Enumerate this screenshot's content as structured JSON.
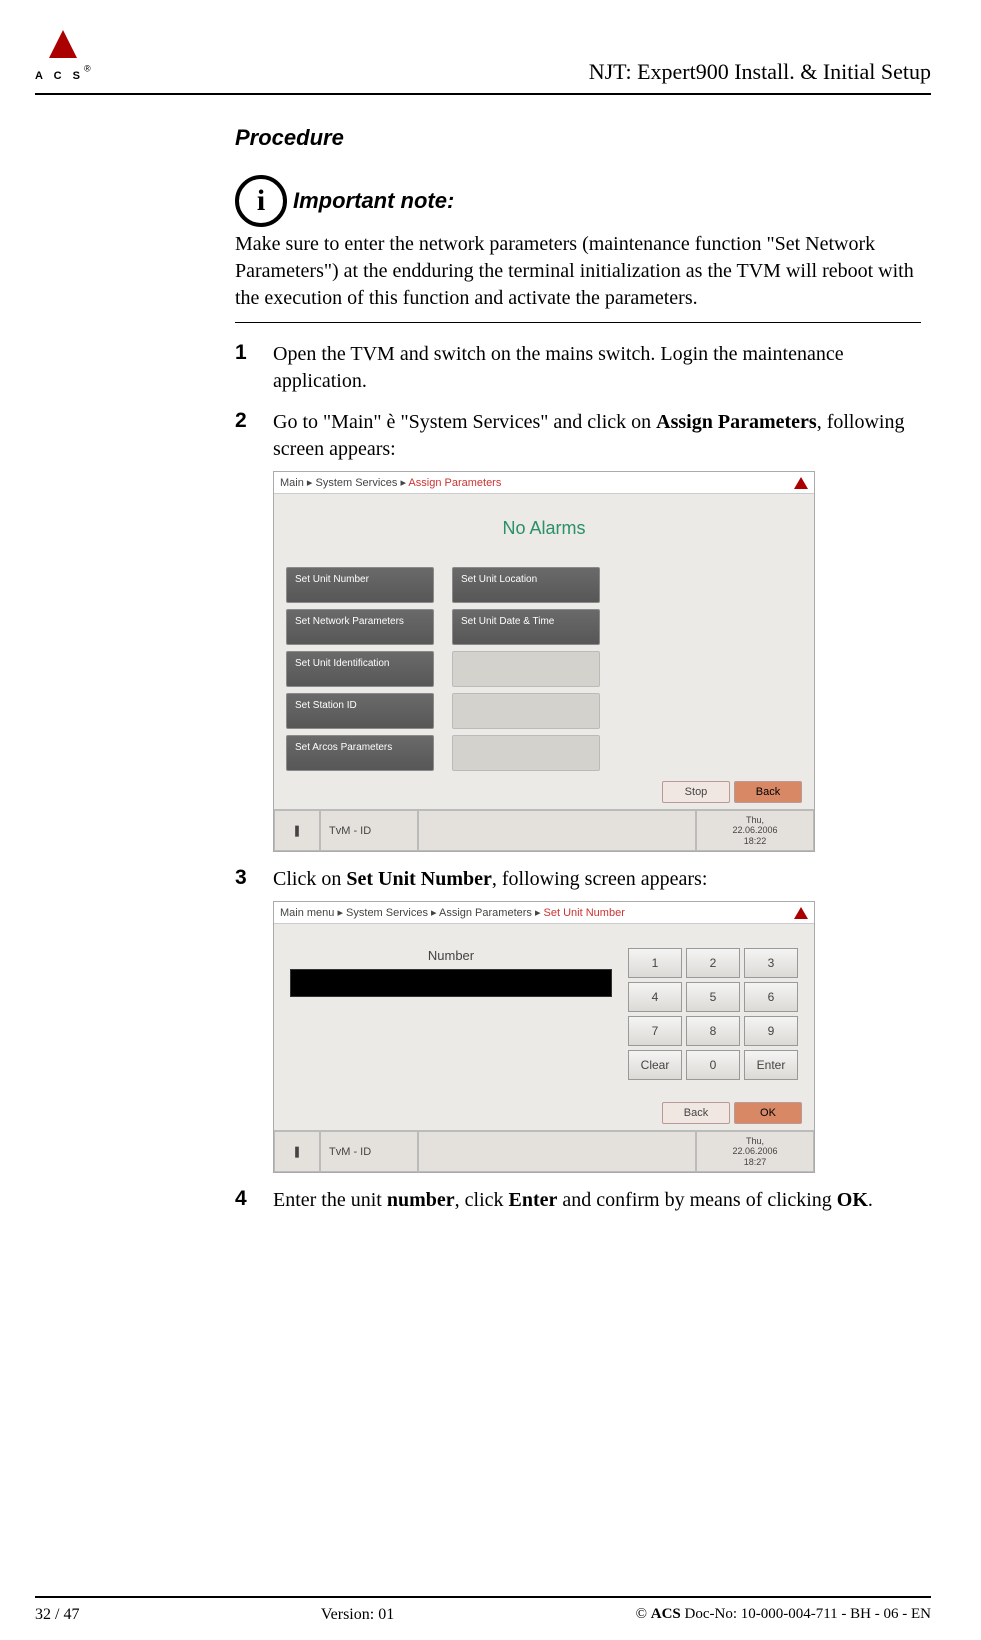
{
  "logo": {
    "letters": "A  C  S",
    "reg": "®"
  },
  "header": {
    "title": "NJT: Expert900 Install. & Initial Setup"
  },
  "section": {
    "procedure": "Procedure",
    "important": "Important note:"
  },
  "note": "Make sure to enter the network parameters (maintenance function \"Set Network Parameters\") at the endduring the terminal initialization as the TVM will reboot with the execution of this function and activate the parameters.",
  "steps": {
    "1": "Open the TVM and switch on the mains switch. Login the maintenance application.",
    "2a": "Go to \"Main\" ",
    "2arrow": "è",
    "2b": "  \"System Services\" and click on ",
    "2bold": "Assign Parameters",
    "2c": ", following screen appears:",
    "3a": "Click on ",
    "3bold": "Set Unit Number",
    "3b": ", following screen appears:",
    "4a": "Enter the unit ",
    "4b": "number",
    "4c": ", click ",
    "4d": "Enter",
    "4e": " and confirm by means of clicking ",
    "4f": "OK",
    "4g": "."
  },
  "shot1": {
    "crumb1": "Main ▸ System Services ▸ ",
    "crumb1red": "Assign Parameters",
    "noalarm": "No Alarms",
    "left": [
      "Set Unit Number",
      "Set Network Parameters",
      "Set Unit Identification",
      "Set Station ID",
      "Set Arcos Parameters"
    ],
    "right": [
      "Set Unit Location",
      "Set Unit Date & Time"
    ],
    "stop": "Stop",
    "back": "Back",
    "tvm": "TvM - ID",
    "day": "Thu,",
    "date": "22.06.2006",
    "time": "18:22"
  },
  "shot2": {
    "crumb": "Main menu ▸ System Services ▸ Assign Parameters ▸ ",
    "crumbred": "Set Unit Number",
    "label": "Number",
    "keys": [
      "1",
      "2",
      "3",
      "4",
      "5",
      "6",
      "7",
      "8",
      "9",
      "Clear",
      "0",
      "Enter"
    ],
    "back": "Back",
    "ok": "OK",
    "tvm": "TvM - ID",
    "day": "Thu,",
    "date": "22.06.2006",
    "time": "18:27"
  },
  "footer": {
    "page": "32 / 47",
    "version": "Version: 01",
    "copy": "© ",
    "acs": "ACS",
    "doc": " Doc-No: 10-000-004-711 - BH - 06 - EN"
  }
}
